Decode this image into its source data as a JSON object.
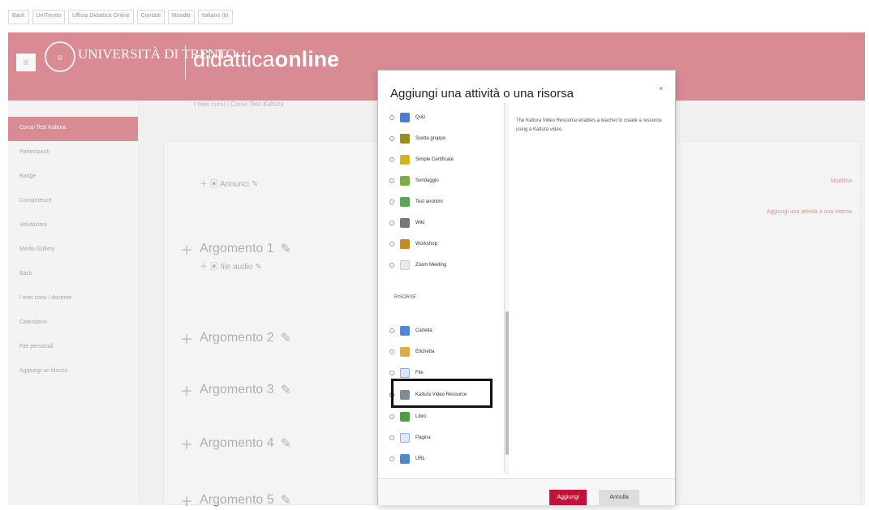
{
  "top_nav": [
    "Back",
    "UniTrento",
    "Ufficio Didattica Online",
    "Contatti",
    "Moodle",
    "Italiano (it)"
  ],
  "header": {
    "university": "UNIVERSITÀ DI TRENTO",
    "brand_main": "didattica",
    "brand_bold": "online"
  },
  "sidebar": [
    "Corso Test Kaltura",
    "Partecipanti",
    "Badge",
    "Competenze",
    "Valutazioni",
    "Media Gallery",
    "Back",
    "I miei corsi / docente",
    "Calendario",
    "File personali",
    "Aggiungi un blocco"
  ],
  "main": {
    "breadcrumb": "I miei corsi / Corso Test Kaltura",
    "topics": [
      "Argomento 1",
      "Argomento 2",
      "Argomento 3",
      "Argomento 4",
      "Argomento 5"
    ],
    "announcement": "Annunci",
    "subfile": "file audio",
    "edit_label": "Modifica",
    "add_activity": "Aggiungi una attività o una risorsa"
  },
  "modal": {
    "title": "Aggiungi una attività o una risorsa",
    "close": "×",
    "section_resources": "RISORSE",
    "description": "The Kaltura Video Resource enables a teacher to create a resource using a Kaltura video.",
    "activities": [
      "Quiz",
      "Scelta gruppo",
      "Simple Certificate",
      "Sondaggio",
      "Test anonimi",
      "Wiki",
      "Workshop",
      "Zoom Meeting"
    ],
    "resources": [
      "Cartella",
      "Etichetta",
      "File",
      "Kaltura Video Resource",
      "Libro",
      "Pagina",
      "URL"
    ],
    "buttons": {
      "add": "Aggiungi",
      "cancel": "Annulla"
    }
  },
  "colors": {
    "brand": "#b5212e",
    "add_button": "#c2123a"
  }
}
